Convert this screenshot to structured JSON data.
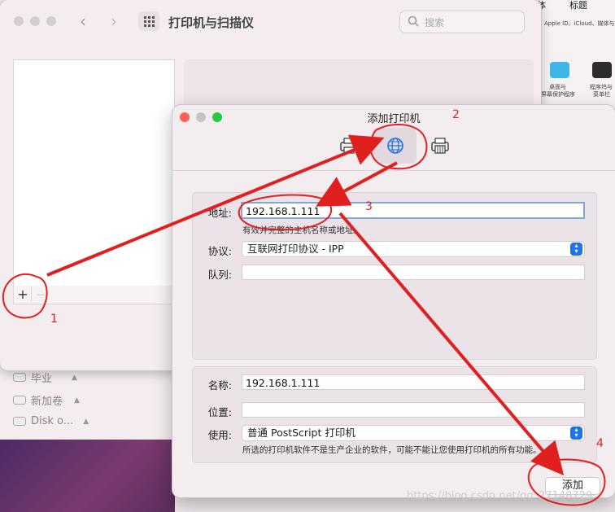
{
  "back_window": {
    "title": "打印机与扫描仪",
    "search_placeholder": "搜索",
    "add_symbol": "+",
    "remove_symbol": "—"
  },
  "right_panel": {
    "top_items": [
      "体",
      "标题"
    ],
    "account_text": "Apple ID、iCloud、媒体与",
    "icons": [
      {
        "label_line1": "桌面与",
        "label_line2": "屏幕保护程序",
        "color": "#3fb7e6"
      },
      {
        "label_line1": "程序坞与",
        "label_line2": "菜单栏",
        "color": "#2c2c2c"
      }
    ]
  },
  "sidebar": {
    "items": [
      {
        "label": "毕业"
      },
      {
        "label": "新加卷"
      },
      {
        "label": "Disk o..."
      }
    ]
  },
  "dialog": {
    "title": "添加打印机",
    "address_label": "地址:",
    "address_value": "192.168.1.111",
    "address_hint": "有效并完整的主机名称或地址。",
    "protocol_label": "协议:",
    "protocol_value": "互联网打印协议 - IPP",
    "queue_label": "队列:",
    "queue_value": "",
    "name_label": "名称:",
    "name_value": "192.168.1.111",
    "location_label": "位置:",
    "location_value": "",
    "use_label": "使用:",
    "use_value": "普通 PostScript 打印机",
    "driver_note": "所选的打印机软件不是生产企业的软件，可能不能让您使用打印机的所有功能。",
    "add_button": "添加"
  },
  "annotations": [
    "1",
    "2",
    "3",
    "4"
  ],
  "watermark": "https://blog.csdn.net/qq_27148729",
  "colors": {
    "annotation": "#e0201f",
    "accent": "#1f73e6",
    "focus": "#7da7df"
  }
}
